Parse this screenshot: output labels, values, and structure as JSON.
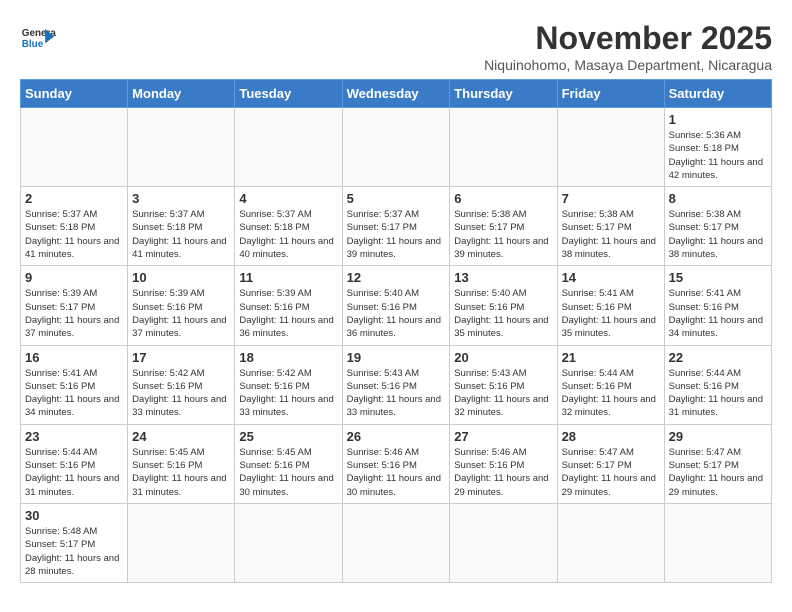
{
  "header": {
    "logo_line1": "General",
    "logo_line2": "Blue",
    "month_title": "November 2025",
    "subtitle": "Niquinohomo, Masaya Department, Nicaragua"
  },
  "days_of_week": [
    "Sunday",
    "Monday",
    "Tuesday",
    "Wednesday",
    "Thursday",
    "Friday",
    "Saturday"
  ],
  "weeks": [
    [
      {
        "day": "",
        "info": ""
      },
      {
        "day": "",
        "info": ""
      },
      {
        "day": "",
        "info": ""
      },
      {
        "day": "",
        "info": ""
      },
      {
        "day": "",
        "info": ""
      },
      {
        "day": "",
        "info": ""
      },
      {
        "day": "1",
        "info": "Sunrise: 5:36 AM\nSunset: 5:18 PM\nDaylight: 11 hours and 42 minutes."
      }
    ],
    [
      {
        "day": "2",
        "info": "Sunrise: 5:37 AM\nSunset: 5:18 PM\nDaylight: 11 hours and 41 minutes."
      },
      {
        "day": "3",
        "info": "Sunrise: 5:37 AM\nSunset: 5:18 PM\nDaylight: 11 hours and 41 minutes."
      },
      {
        "day": "4",
        "info": "Sunrise: 5:37 AM\nSunset: 5:18 PM\nDaylight: 11 hours and 40 minutes."
      },
      {
        "day": "5",
        "info": "Sunrise: 5:37 AM\nSunset: 5:17 PM\nDaylight: 11 hours and 39 minutes."
      },
      {
        "day": "6",
        "info": "Sunrise: 5:38 AM\nSunset: 5:17 PM\nDaylight: 11 hours and 39 minutes."
      },
      {
        "day": "7",
        "info": "Sunrise: 5:38 AM\nSunset: 5:17 PM\nDaylight: 11 hours and 38 minutes."
      },
      {
        "day": "8",
        "info": "Sunrise: 5:38 AM\nSunset: 5:17 PM\nDaylight: 11 hours and 38 minutes."
      }
    ],
    [
      {
        "day": "9",
        "info": "Sunrise: 5:39 AM\nSunset: 5:17 PM\nDaylight: 11 hours and 37 minutes."
      },
      {
        "day": "10",
        "info": "Sunrise: 5:39 AM\nSunset: 5:16 PM\nDaylight: 11 hours and 37 minutes."
      },
      {
        "day": "11",
        "info": "Sunrise: 5:39 AM\nSunset: 5:16 PM\nDaylight: 11 hours and 36 minutes."
      },
      {
        "day": "12",
        "info": "Sunrise: 5:40 AM\nSunset: 5:16 PM\nDaylight: 11 hours and 36 minutes."
      },
      {
        "day": "13",
        "info": "Sunrise: 5:40 AM\nSunset: 5:16 PM\nDaylight: 11 hours and 35 minutes."
      },
      {
        "day": "14",
        "info": "Sunrise: 5:41 AM\nSunset: 5:16 PM\nDaylight: 11 hours and 35 minutes."
      },
      {
        "day": "15",
        "info": "Sunrise: 5:41 AM\nSunset: 5:16 PM\nDaylight: 11 hours and 34 minutes."
      }
    ],
    [
      {
        "day": "16",
        "info": "Sunrise: 5:41 AM\nSunset: 5:16 PM\nDaylight: 11 hours and 34 minutes."
      },
      {
        "day": "17",
        "info": "Sunrise: 5:42 AM\nSunset: 5:16 PM\nDaylight: 11 hours and 33 minutes."
      },
      {
        "day": "18",
        "info": "Sunrise: 5:42 AM\nSunset: 5:16 PM\nDaylight: 11 hours and 33 minutes."
      },
      {
        "day": "19",
        "info": "Sunrise: 5:43 AM\nSunset: 5:16 PM\nDaylight: 11 hours and 33 minutes."
      },
      {
        "day": "20",
        "info": "Sunrise: 5:43 AM\nSunset: 5:16 PM\nDaylight: 11 hours and 32 minutes."
      },
      {
        "day": "21",
        "info": "Sunrise: 5:44 AM\nSunset: 5:16 PM\nDaylight: 11 hours and 32 minutes."
      },
      {
        "day": "22",
        "info": "Sunrise: 5:44 AM\nSunset: 5:16 PM\nDaylight: 11 hours and 31 minutes."
      }
    ],
    [
      {
        "day": "23",
        "info": "Sunrise: 5:44 AM\nSunset: 5:16 PM\nDaylight: 11 hours and 31 minutes."
      },
      {
        "day": "24",
        "info": "Sunrise: 5:45 AM\nSunset: 5:16 PM\nDaylight: 11 hours and 31 minutes."
      },
      {
        "day": "25",
        "info": "Sunrise: 5:45 AM\nSunset: 5:16 PM\nDaylight: 11 hours and 30 minutes."
      },
      {
        "day": "26",
        "info": "Sunrise: 5:46 AM\nSunset: 5:16 PM\nDaylight: 11 hours and 30 minutes."
      },
      {
        "day": "27",
        "info": "Sunrise: 5:46 AM\nSunset: 5:16 PM\nDaylight: 11 hours and 29 minutes."
      },
      {
        "day": "28",
        "info": "Sunrise: 5:47 AM\nSunset: 5:17 PM\nDaylight: 11 hours and 29 minutes."
      },
      {
        "day": "29",
        "info": "Sunrise: 5:47 AM\nSunset: 5:17 PM\nDaylight: 11 hours and 29 minutes."
      }
    ],
    [
      {
        "day": "30",
        "info": "Sunrise: 5:48 AM\nSunset: 5:17 PM\nDaylight: 11 hours and 28 minutes."
      },
      {
        "day": "",
        "info": ""
      },
      {
        "day": "",
        "info": ""
      },
      {
        "day": "",
        "info": ""
      },
      {
        "day": "",
        "info": ""
      },
      {
        "day": "",
        "info": ""
      },
      {
        "day": "",
        "info": ""
      }
    ]
  ]
}
